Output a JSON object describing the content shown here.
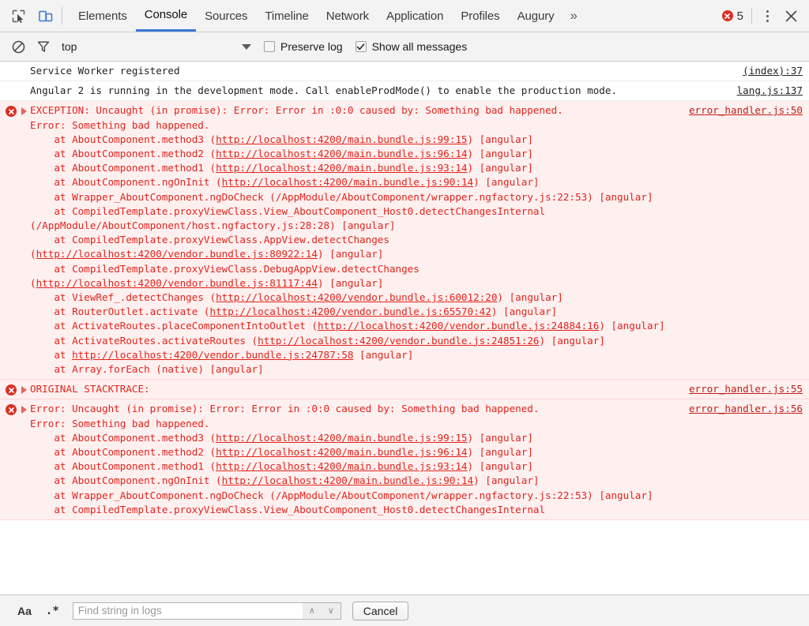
{
  "toolbar": {
    "inspect_icon": "inspect-cursor-icon",
    "device_icon": "device-toolbar-icon",
    "tabs": [
      {
        "label": "Elements",
        "active": false
      },
      {
        "label": "Console",
        "active": true
      },
      {
        "label": "Sources",
        "active": false
      },
      {
        "label": "Timeline",
        "active": false
      },
      {
        "label": "Network",
        "active": false
      },
      {
        "label": "Application",
        "active": false
      },
      {
        "label": "Profiles",
        "active": false
      },
      {
        "label": "Augury",
        "active": false
      }
    ],
    "more_tabs_label": "»",
    "error_count": "5",
    "accent_color": "#3879d9",
    "error_color": "#d93025"
  },
  "filterbar": {
    "clear_icon": "clear-console-icon",
    "filter_icon": "filter-funnel-icon",
    "context_value": "top",
    "preserve_log_label": "Preserve log",
    "preserve_log_checked": false,
    "show_all_label": "Show all messages",
    "show_all_checked": true
  },
  "console": {
    "messages": [
      {
        "level": "info",
        "expandable": false,
        "source": "(index):37",
        "text": "Service Worker registered"
      },
      {
        "level": "info",
        "expandable": false,
        "source": "lang.js:137",
        "text": "Angular 2 is running in the development mode. Call enableProdMode() to enable the production mode."
      },
      {
        "level": "error",
        "expandable": true,
        "source": "error_handler.js:50",
        "text": "EXCEPTION: Uncaught (in promise): Error: Error in :0:0 caused by: Something bad happened.\nError: Something bad happened.\n    at AboutComponent.method3 (http://localhost:4200/main.bundle.js:99:15) [angular]\n    at AboutComponent.method2 (http://localhost:4200/main.bundle.js:96:14) [angular]\n    at AboutComponent.method1 (http://localhost:4200/main.bundle.js:93:14) [angular]\n    at AboutComponent.ngOnInit (http://localhost:4200/main.bundle.js:90:14) [angular]\n    at Wrapper_AboutComponent.ngDoCheck (/AppModule/AboutComponent/wrapper.ngfactory.js:22:53) [angular]\n    at CompiledTemplate.proxyViewClass.View_AboutComponent_Host0.detectChangesInternal (/AppModule/AboutComponent/host.ngfactory.js:28:28) [angular]\n    at CompiledTemplate.proxyViewClass.AppView.detectChanges (http://localhost:4200/vendor.bundle.js:80922:14) [angular]\n    at CompiledTemplate.proxyViewClass.DebugAppView.detectChanges (http://localhost:4200/vendor.bundle.js:81117:44) [angular]\n    at ViewRef_.detectChanges (http://localhost:4200/vendor.bundle.js:60012:20) [angular]\n    at RouterOutlet.activate (http://localhost:4200/vendor.bundle.js:65570:42) [angular]\n    at ActivateRoutes.placeComponentIntoOutlet (http://localhost:4200/vendor.bundle.js:24884:16) [angular]\n    at ActivateRoutes.activateRoutes (http://localhost:4200/vendor.bundle.js:24851:26) [angular]\n    at http://localhost:4200/vendor.bundle.js:24787:58 [angular]\n    at Array.forEach (native) [angular]"
      },
      {
        "level": "error",
        "expandable": true,
        "source": "error_handler.js:55",
        "text": "ORIGINAL STACKTRACE:"
      },
      {
        "level": "error",
        "expandable": true,
        "source": "error_handler.js:56",
        "text": "Error: Uncaught (in promise): Error: Error in :0:0 caused by: Something bad happened.\nError: Something bad happened.\n    at AboutComponent.method3 (http://localhost:4200/main.bundle.js:99:15) [angular]\n    at AboutComponent.method2 (http://localhost:4200/main.bundle.js:96:14) [angular]\n    at AboutComponent.method1 (http://localhost:4200/main.bundle.js:93:14) [angular]\n    at AboutComponent.ngOnInit (http://localhost:4200/main.bundle.js:90:14) [angular]\n    at Wrapper_AboutComponent.ngDoCheck (/AppModule/AboutComponent/wrapper.ngfactory.js:22:53) [angular]\n    at CompiledTemplate.proxyViewClass.View_AboutComponent_Host0.detectChangesInternal"
      }
    ]
  },
  "findbar": {
    "match_case_label": "Aa",
    "regex_label": ".*",
    "search_placeholder": "Find string in logs",
    "search_value": "",
    "prev_label": "∧",
    "next_label": "∨",
    "cancel_label": "Cancel"
  }
}
